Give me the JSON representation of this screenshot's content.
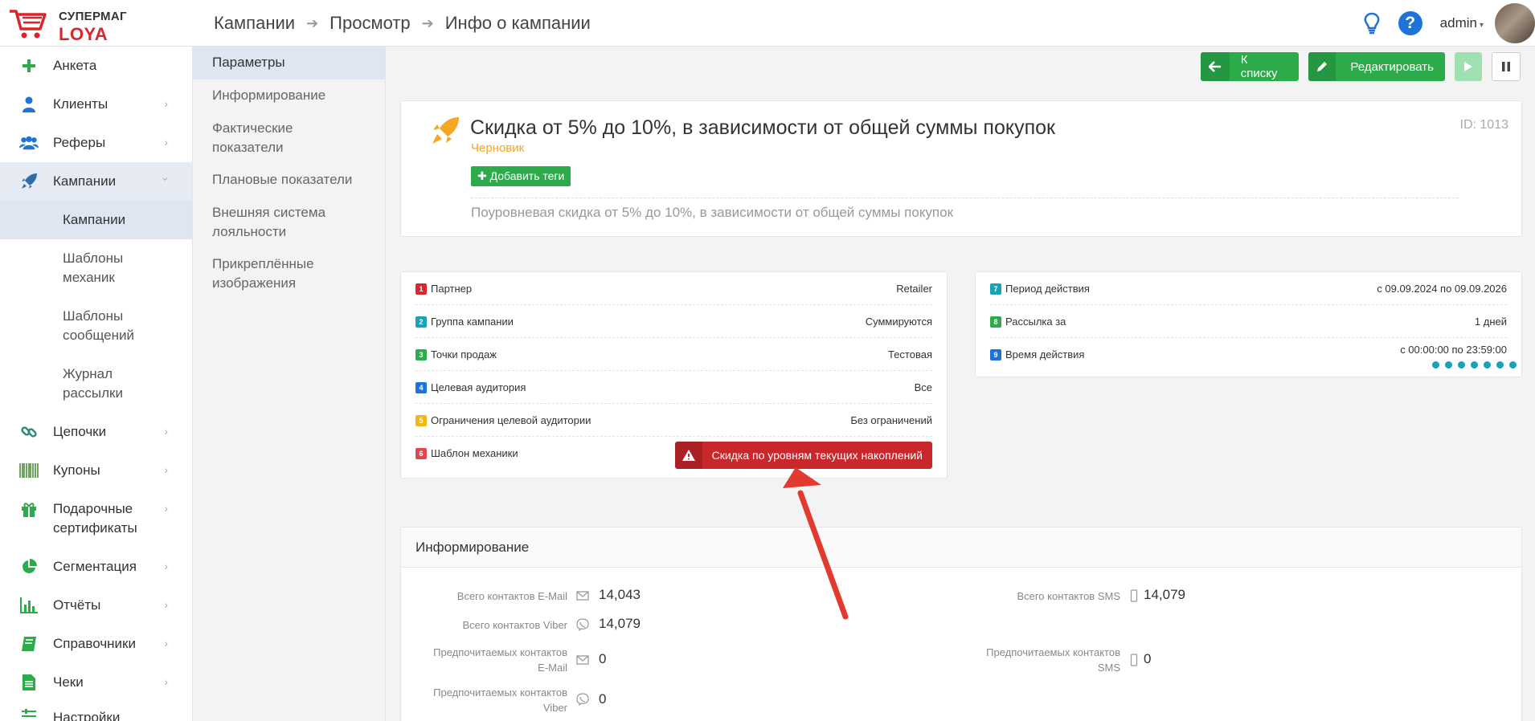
{
  "app": {
    "brand_top": "СУПЕРМАГ",
    "brand_bottom": "LOYA",
    "user": "admin"
  },
  "breadcrumbs": [
    "Кампании",
    "Просмотр",
    "Инфо о кампании"
  ],
  "sidebar": {
    "items": [
      {
        "label": "Анкета"
      },
      {
        "label": "Клиенты"
      },
      {
        "label": "Реферы"
      },
      {
        "label": "Кампании"
      },
      {
        "label": "Цепочки"
      },
      {
        "label": "Купоны"
      },
      {
        "label": "Подарочные сертификаты"
      },
      {
        "label": "Сегментация"
      },
      {
        "label": "Отчёты"
      },
      {
        "label": "Справочники"
      },
      {
        "label": "Чеки"
      },
      {
        "label": "Настройки"
      }
    ],
    "sub": [
      {
        "label": "Кампании"
      },
      {
        "label": "Шаблоны механик"
      },
      {
        "label": "Шаблоны сообщений"
      },
      {
        "label": "Журнал рассылки"
      }
    ]
  },
  "subnav": [
    {
      "label": "Параметры"
    },
    {
      "label": "Информирование"
    },
    {
      "label": "Фактические показатели"
    },
    {
      "label": "Плановые показатели"
    },
    {
      "label": "Внешняя система лояльности"
    },
    {
      "label": "Прикреплённые изображения"
    }
  ],
  "actions": {
    "back": "К списку",
    "edit": "Редактировать"
  },
  "campaign": {
    "title": "Скидка от 5% до 10%, в зависимости от общей суммы покупок",
    "status": "Черновик",
    "add_tags": "Добавить теги",
    "id_label": "ID: 1013",
    "description": "Поуровневая скидка от 5% до 10%, в зависимости от общей суммы покупок"
  },
  "params": [
    {
      "num": "1",
      "key": "Партнер",
      "value": "Retailer",
      "color": "#d9262c"
    },
    {
      "num": "2",
      "key": "Группа кампании",
      "value": "Суммируются",
      "color": "#17a2b8"
    },
    {
      "num": "3",
      "key": "Точки продаж",
      "value": "Тестовая",
      "color": "#2bab4a"
    },
    {
      "num": "4",
      "key": "Целевая аудитория",
      "value": "Все",
      "color": "#1e73d8"
    },
    {
      "num": "5",
      "key": "Ограничения целевой аудитории",
      "value": "Без ограничений",
      "color": "#f5b70f"
    },
    {
      "num": "6",
      "key": "Шаблон механики",
      "value": "Скидка по уровням текущих накоплений",
      "color": "#e0464b"
    }
  ],
  "period": [
    {
      "num": "7",
      "key": "Период действия",
      "value": "с 09.09.2024 по 09.09.2026",
      "color": "#17a2b8"
    },
    {
      "num": "8",
      "key": "Рассылка за",
      "value": "1 дней",
      "color": "#2bab4a"
    },
    {
      "num": "9",
      "key": "Время действия",
      "value": "с 00:00:00 по 23:59:00",
      "color": "#1e73d8"
    }
  ],
  "informing": {
    "title": "Информирование",
    "email_total_label": "Всего контактов E-Mail",
    "email_total": "14,043",
    "viber_total_label": "Всего контактов Viber",
    "viber_total": "14,079",
    "email_pref_label_1": "Предпочитаемых контактов",
    "email_pref_label_2": "E-Mail",
    "email_pref": "0",
    "viber_pref_label_1": "Предпочитаемых контактов",
    "viber_pref_label_2": "Viber",
    "viber_pref": "0",
    "sms_total_label": "Всего контактов SMS",
    "sms_total": "14,079",
    "sms_pref_label_1": "Предпочитаемых контактов",
    "sms_pref_label_2": "SMS",
    "sms_pref": "0"
  }
}
